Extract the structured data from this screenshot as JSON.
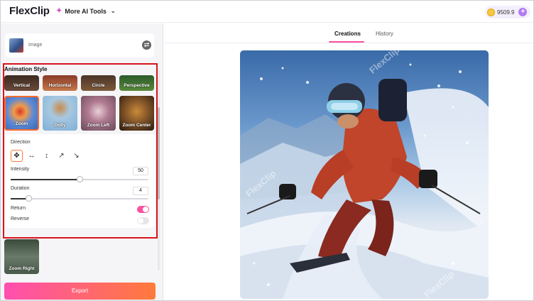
{
  "header": {
    "logo_text": "FlexClip",
    "ai_tools_label": "More AI Tools",
    "credits": "9509.9"
  },
  "sidebar": {
    "image_label": "Image",
    "animation_style_title": "Animation Style",
    "styles": [
      {
        "label": "Vertical"
      },
      {
        "label": "Horizontal"
      },
      {
        "label": "Circle"
      },
      {
        "label": "Perspective"
      },
      {
        "label": "Zoom",
        "selected": true
      },
      {
        "label": "Dolly"
      },
      {
        "label": "Zoom Left"
      },
      {
        "label": "Zoom Center"
      },
      {
        "label": "Zoom Right"
      }
    ],
    "direction_label": "Direction",
    "directions": [
      "move-all-icon",
      "horizontal-arrows-icon",
      "vertical-arrows-icon",
      "diagonal-up-right-icon",
      "diagonal-down-right-icon"
    ],
    "intensity_label": "Intensity",
    "intensity_value": "50",
    "intensity_level": 0.5,
    "duration_label": "Duration",
    "duration_value": "4",
    "duration_level": 0.13,
    "return_label": "Return",
    "return_on": true,
    "reverse_label": "Reverse",
    "reverse_on": false,
    "export_label": "Export"
  },
  "main": {
    "tabs": [
      {
        "label": "Creations",
        "active": true
      },
      {
        "label": "History",
        "active": false
      }
    ],
    "watermark": "FlexClip"
  },
  "colors": {
    "accent_pink": "#ff4fa0",
    "accent_orange": "#ff7a3a",
    "highlight_red": "#d9141c"
  }
}
